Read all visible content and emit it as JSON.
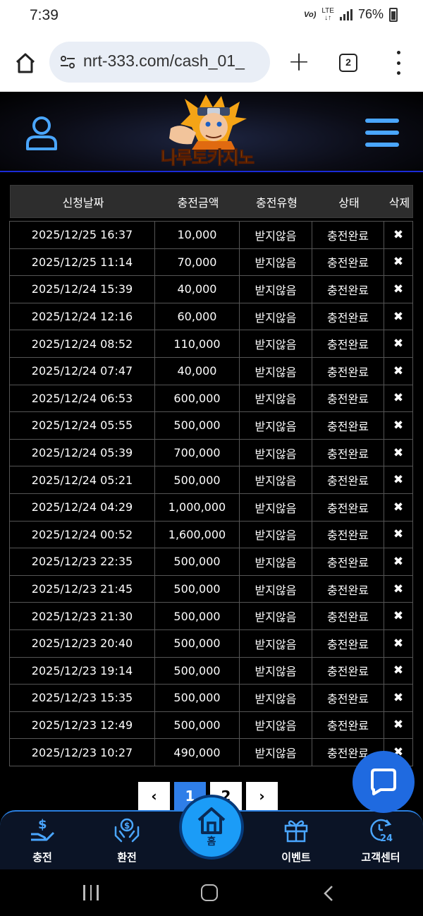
{
  "status_bar": {
    "time": "7:39",
    "volte": "Vo)",
    "lte": "LTE",
    "battery": "76%"
  },
  "browser": {
    "url": "nrt-333.com/cash_01_",
    "tab_count": "2"
  },
  "site": {
    "logo_text": "나루토카지노"
  },
  "table": {
    "headers": [
      "신청날짜",
      "충전금액",
      "충전유형",
      "상태",
      "삭제"
    ],
    "rows": [
      {
        "date": "2025/12/25 16:37",
        "amount": "10,000",
        "type": "받지않음",
        "status": "충전완료"
      },
      {
        "date": "2025/12/25 11:14",
        "amount": "70,000",
        "type": "받지않음",
        "status": "충전완료"
      },
      {
        "date": "2025/12/24 15:39",
        "amount": "40,000",
        "type": "받지않음",
        "status": "충전완료"
      },
      {
        "date": "2025/12/24 12:16",
        "amount": "60,000",
        "type": "받지않음",
        "status": "충전완료"
      },
      {
        "date": "2025/12/24 08:52",
        "amount": "110,000",
        "type": "받지않음",
        "status": "충전완료"
      },
      {
        "date": "2025/12/24 07:47",
        "amount": "40,000",
        "type": "받지않음",
        "status": "충전완료"
      },
      {
        "date": "2025/12/24 06:53",
        "amount": "600,000",
        "type": "받지않음",
        "status": "충전완료"
      },
      {
        "date": "2025/12/24 05:55",
        "amount": "500,000",
        "type": "받지않음",
        "status": "충전완료"
      },
      {
        "date": "2025/12/24 05:39",
        "amount": "700,000",
        "type": "받지않음",
        "status": "충전완료"
      },
      {
        "date": "2025/12/24 05:21",
        "amount": "500,000",
        "type": "받지않음",
        "status": "충전완료"
      },
      {
        "date": "2025/12/24 04:29",
        "amount": "1,000,000",
        "type": "받지않음",
        "status": "충전완료"
      },
      {
        "date": "2025/12/24 00:52",
        "amount": "1,600,000",
        "type": "받지않음",
        "status": "충전완료"
      },
      {
        "date": "2025/12/23 22:35",
        "amount": "500,000",
        "type": "받지않음",
        "status": "충전완료"
      },
      {
        "date": "2025/12/23 21:45",
        "amount": "500,000",
        "type": "받지않음",
        "status": "충전완료"
      },
      {
        "date": "2025/12/23 21:30",
        "amount": "500,000",
        "type": "받지않음",
        "status": "충전완료"
      },
      {
        "date": "2025/12/23 20:40",
        "amount": "500,000",
        "type": "받지않음",
        "status": "충전완료"
      },
      {
        "date": "2025/12/23 19:14",
        "amount": "500,000",
        "type": "받지않음",
        "status": "충전완료"
      },
      {
        "date": "2025/12/23 15:35",
        "amount": "500,000",
        "type": "받지않음",
        "status": "충전완료"
      },
      {
        "date": "2025/12/23 12:49",
        "amount": "500,000",
        "type": "받지않음",
        "status": "충전완료"
      },
      {
        "date": "2025/12/23 10:27",
        "amount": "490,000",
        "type": "받지않음",
        "status": "충전완료"
      }
    ],
    "delete_symbol": "✖"
  },
  "pagination": {
    "prev": "‹",
    "pages": [
      "1",
      "2"
    ],
    "current": "1",
    "next": "›"
  },
  "bottom_nav": {
    "items": [
      {
        "label": "충전",
        "icon": "deposit-icon"
      },
      {
        "label": "환전",
        "icon": "withdraw-icon"
      },
      {
        "label": "홈",
        "icon": "home-icon"
      },
      {
        "label": "이벤트",
        "icon": "gift-icon"
      },
      {
        "label": "고객센터",
        "icon": "support-24-icon"
      }
    ]
  },
  "colors": {
    "accent": "#1b9cf7",
    "header_border": "#1a2bd6",
    "active_page": "#2f7ee8",
    "logo": "#ffb01c"
  }
}
